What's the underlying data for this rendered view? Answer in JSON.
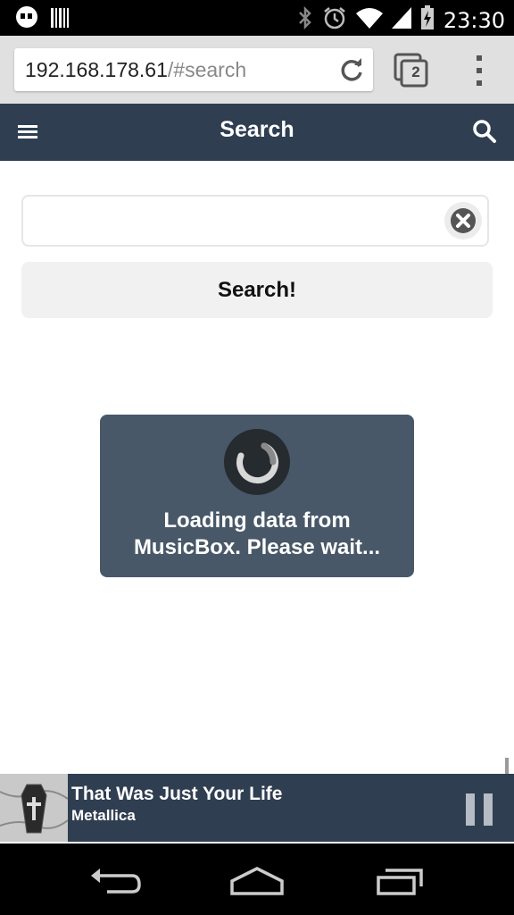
{
  "status_bar": {
    "time": "23:30",
    "icons": [
      "hangouts-icon",
      "barcode-icon",
      "bluetooth-icon",
      "alarm-icon",
      "wifi-icon",
      "signal-icon",
      "battery-icon"
    ]
  },
  "browser": {
    "url_host": "192.168.178.61",
    "url_path": "/#search",
    "tab_count": "2"
  },
  "app_bar": {
    "title": "Search"
  },
  "search": {
    "value": "",
    "placeholder": "",
    "button_label": "Search!"
  },
  "loading": {
    "message_line1": "Loading data from",
    "message_line2": "MusicBox. Please wait..."
  },
  "player": {
    "track": "That Was Just Your Life",
    "artist": "Metallica"
  },
  "colors": {
    "app_bar": "#2f3e51",
    "loader": "#485868",
    "chrome": "#e0e0e0"
  }
}
